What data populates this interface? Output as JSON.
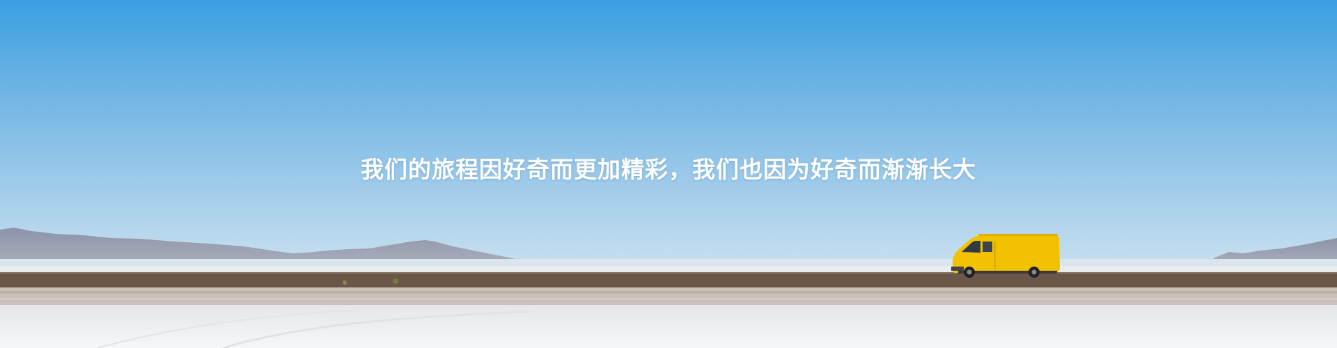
{
  "banner": {
    "headline": "我们的旅程因好奇而更加精彩，我们也因为好奇而渐渐长大"
  },
  "colors": {
    "sky_top": "#3a9fe0",
    "sky_bottom": "#c9e0ef",
    "mountains": "#8f97ab",
    "road": "#6b5648",
    "salt_flat": "#f3f4f6",
    "van": "#f2c200",
    "text": "#ffffff"
  }
}
